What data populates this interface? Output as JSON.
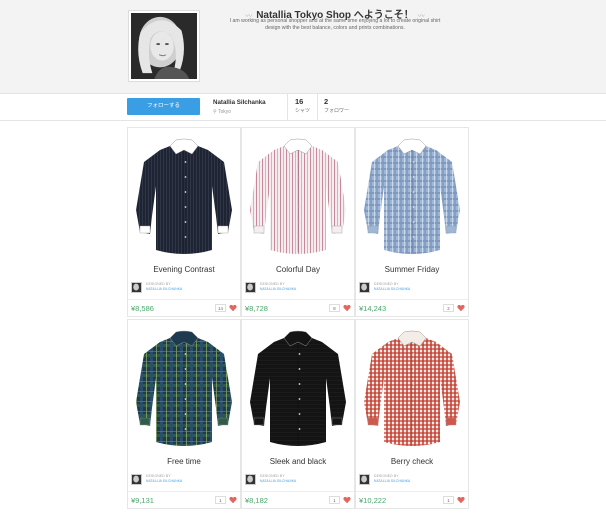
{
  "header": {
    "shop_title": "Natallia Tokyo Shop へようこそ！",
    "description": "I am working as personal shopper and at the same time enjoying a lot to create original shirt design with the best balance, colors and prints combinations."
  },
  "profile": {
    "follow_label": "フォローする",
    "name": "Natallia Silchanka",
    "location": "Tokyo",
    "shirts_count": "16",
    "shirts_label": "シャツ",
    "followers_count": "2",
    "followers_label": "フォロワー"
  },
  "designed_by_label": "DESIGNED BY",
  "designer_name": "NATALLIA SILCHANKA",
  "colors": {
    "accent": "#3a9ee4",
    "price": "#4aa66b",
    "heart": "#e4655f"
  },
  "products": [
    {
      "name": "Evening Contrast",
      "price": "¥8,586",
      "likes": "14"
    },
    {
      "name": "Colorful Day",
      "price": "¥8,728",
      "likes": "8"
    },
    {
      "name": "Summer Friday",
      "price": "¥14,243",
      "likes": "2"
    },
    {
      "name": "Free time",
      "price": "¥9,131",
      "likes": "1"
    },
    {
      "name": "Sleek and black",
      "price": "¥8,182",
      "likes": "1"
    },
    {
      "name": "Berry check",
      "price": "¥10,222",
      "likes": "1"
    }
  ]
}
